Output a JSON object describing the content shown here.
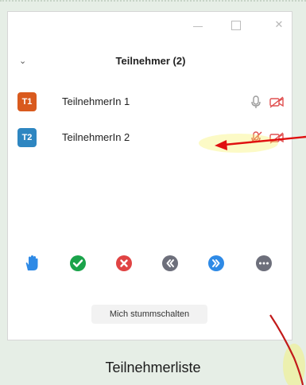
{
  "panel": {
    "title": "Teilnehmer (2)",
    "title_chevron_icon": "chevron-down-icon",
    "window_controls": [
      "minimize-icon",
      "maximize-icon",
      "close-icon"
    ]
  },
  "participants": [
    {
      "initials": "T1",
      "name": "TeilnehmerIn 1",
      "avatar_color": "#d95a1e",
      "mic": "mic-icon",
      "video": "video-off-icon"
    },
    {
      "initials": "T2",
      "name": "TeilnehmerIn 2",
      "avatar_color": "#2e86c1",
      "mic": "mic-muted-icon",
      "video": "video-off-icon"
    }
  ],
  "footer_icons": [
    {
      "name": "raise-hand-icon",
      "color": "#2e8ae6"
    },
    {
      "name": "yes-check-icon",
      "color": "#1aa34a"
    },
    {
      "name": "no-x-icon",
      "color": "#e04343"
    },
    {
      "name": "go-slower-icon",
      "color": "#6d6f7b"
    },
    {
      "name": "go-faster-icon",
      "color": "#2e8ae6"
    },
    {
      "name": "more-icon",
      "color": "#6d6f7b"
    }
  ],
  "mute_button_label": "Mich stummschalten",
  "caption": "Teilnehmerliste",
  "annotation": {
    "arrow_color": "#e01010",
    "highlight_color": "#f5f25c"
  }
}
